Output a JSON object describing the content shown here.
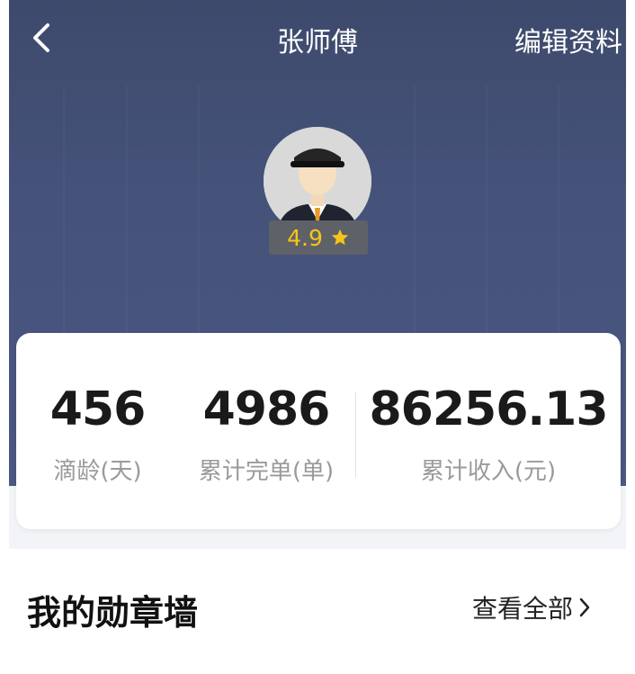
{
  "header": {
    "title": "张师傅",
    "edit_label": "编辑资料",
    "back_icon": "chevron-left-icon"
  },
  "profile": {
    "rating": "4.9",
    "rating_icon": "star-icon",
    "rating_color": "#f5c518"
  },
  "stats": [
    {
      "value": "456",
      "label": "滴龄(天)"
    },
    {
      "value": "4986",
      "label": "累计完单(单)"
    },
    {
      "value": "86256.13",
      "label": "累计收入(元)"
    }
  ],
  "badges": {
    "title": "我的勋章墙",
    "view_all": "查看全部",
    "view_all_icon": "chevron-right-icon"
  },
  "colors": {
    "header_bg": "#45527a",
    "page_bg": "#ffffff"
  }
}
